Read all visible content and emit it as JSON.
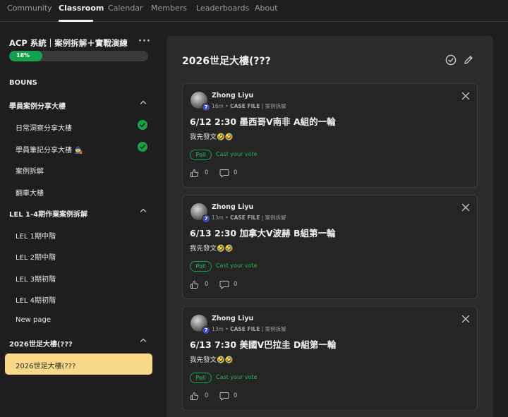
{
  "nav": {
    "tabs": [
      "Community",
      "Classroom",
      "Calendar",
      "Members",
      "Leaderboards",
      "About"
    ],
    "active": "Classroom"
  },
  "sidebar": {
    "course_title": "ACP 系統｜案例拆解＋實戰演練",
    "progress_label": "18%",
    "progress_fraction": 0.18,
    "rows": [
      {
        "label": "BOUNS",
        "kind": "section",
        "chevron": false,
        "checked": false
      },
      {
        "label": "學員案例分享大樓",
        "kind": "section",
        "chevron": true,
        "checked": false
      },
      {
        "label": "日常洞察分享大樓",
        "kind": "item",
        "chevron": false,
        "checked": true
      },
      {
        "label": "學員筆記分享大樓 🧙",
        "kind": "item",
        "chevron": false,
        "checked": true
      },
      {
        "label": "案例拆解",
        "kind": "item",
        "chevron": false,
        "checked": false
      },
      {
        "label": "翻車大樓",
        "kind": "item",
        "chevron": false,
        "checked": false
      },
      {
        "label": "LEL 1-4期作業案例拆解",
        "kind": "section",
        "chevron": true,
        "checked": false
      },
      {
        "label": "LEL 1期中階",
        "kind": "item",
        "chevron": false,
        "checked": false
      },
      {
        "label": "LEL 2期中階",
        "kind": "item",
        "chevron": false,
        "checked": false
      },
      {
        "label": "LEL 3期初階",
        "kind": "item",
        "chevron": false,
        "checked": false
      },
      {
        "label": "LEL 4期初階",
        "kind": "item",
        "chevron": false,
        "checked": false
      },
      {
        "label": "New page",
        "kind": "item",
        "chevron": false,
        "checked": false
      },
      {
        "label": "2026世足大樓(???",
        "kind": "section",
        "chevron": true,
        "checked": false
      }
    ],
    "active_item": "2026世足大樓(???"
  },
  "main": {
    "title": "2026世足大樓(???",
    "posts": [
      {
        "author": "Zhong Liyu",
        "level": "7",
        "time": "16m",
        "category": "CASE FILE",
        "subcategory": "案例拆解",
        "title": "6/12 2:30 墨西哥V南非 A組的一輪",
        "body": "我先發文🤣🤣",
        "poll_label": "Poll",
        "vote_label": "Cast your vote",
        "likes": "0",
        "comments": "0"
      },
      {
        "author": "Zhong Liyu",
        "level": "7",
        "time": "13m",
        "category": "CASE FILE",
        "subcategory": "案例拆解",
        "title": "6/13 2:30 加拿大V波赫 B組第一輪",
        "body": "我先發文🤣🤣",
        "poll_label": "Poll",
        "vote_label": "Cast your vote",
        "likes": "0",
        "comments": "0"
      },
      {
        "author": "Zhong Liyu",
        "level": "7",
        "time": "13m",
        "category": "CASE FILE",
        "subcategory": "案例拆解",
        "title": "6/13 7:30 美國V巴拉圭 D組第一輪",
        "body": "我先發文🤣🤣",
        "poll_label": "Poll",
        "vote_label": "Cast your vote",
        "likes": "0",
        "comments": "0"
      }
    ]
  },
  "colors": {
    "background": "#1e1e1f",
    "panel": "#2b2b2c",
    "accent_green": "#12a24b",
    "active_item": "#f8d98a",
    "level_badge": "#3f4bb5"
  },
  "icons": {
    "more": "more-dots-icon",
    "chevron": "chevron-up-icon",
    "check": "check-circle-icon",
    "mark_complete": "circle-check-icon",
    "edit": "pencil-icon",
    "close": "close-icon",
    "like": "thumbs-up-icon",
    "comment": "comment-icon"
  }
}
